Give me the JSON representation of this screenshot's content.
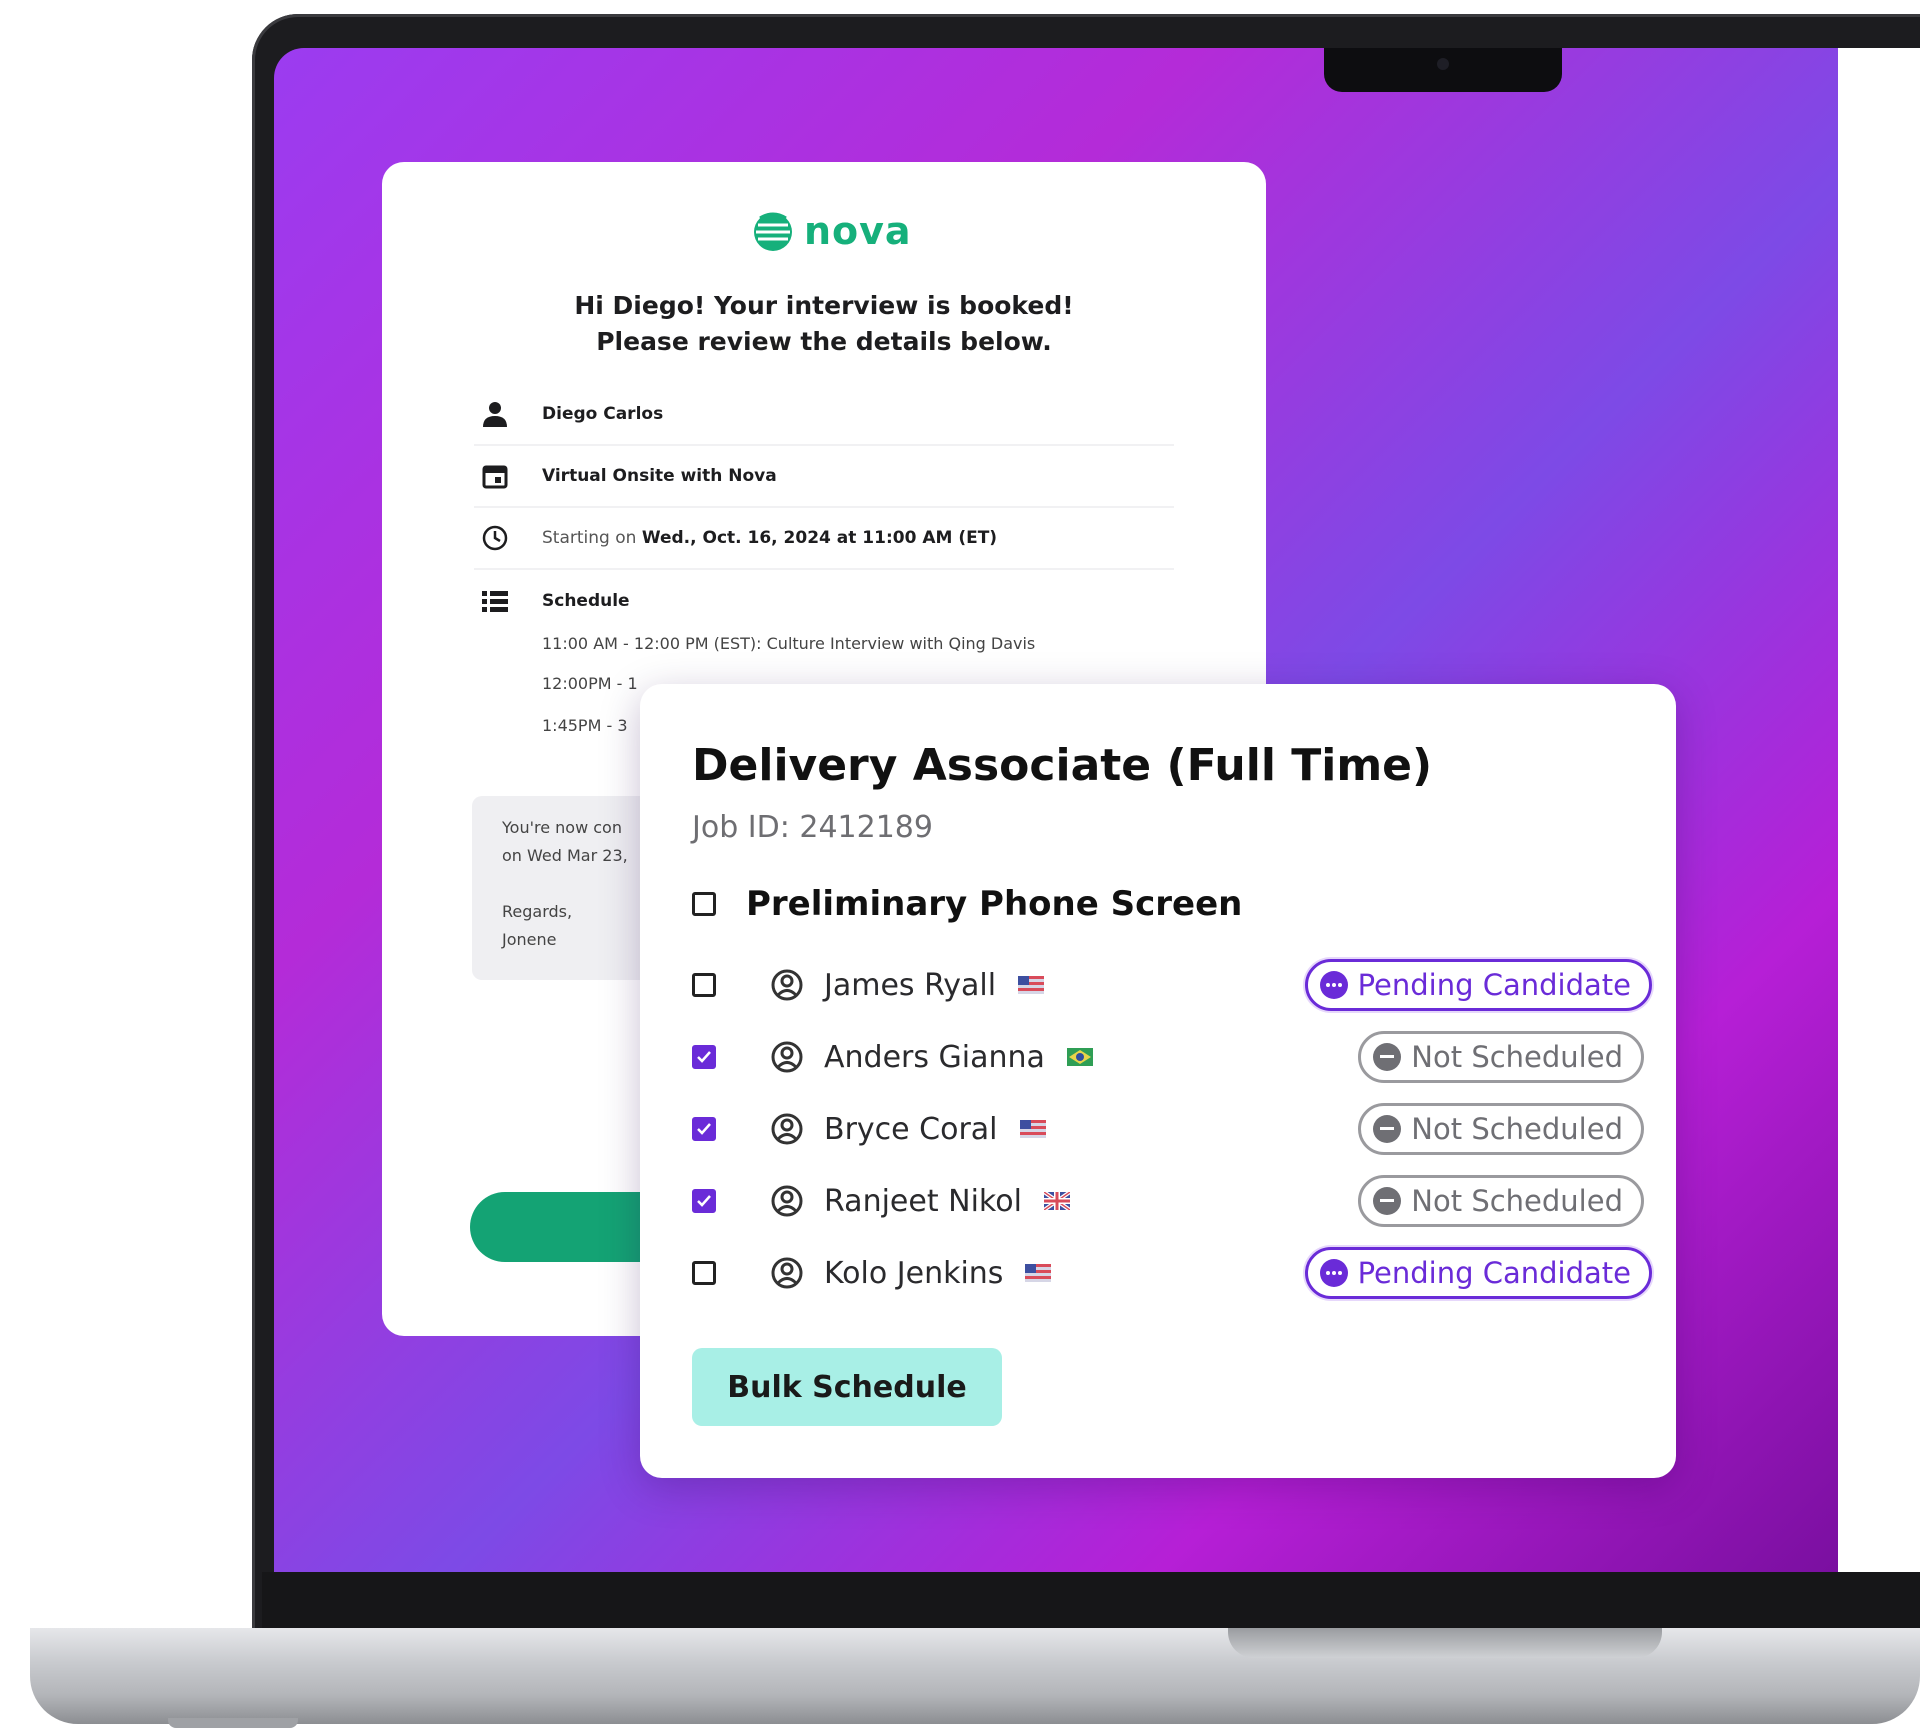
{
  "email": {
    "logo_text": "nova",
    "greeting_line1": "Hi Diego! Your interview is booked!",
    "greeting_line2": "Please review the details below.",
    "candidate_name": "Diego Carlos",
    "event_name": "Virtual Onsite with Nova",
    "starting_prefix": "Starting on",
    "starting_datetime": "Wed., Oct. 16, 2024 at 11:00 AM (ET)",
    "schedule_title": "Schedule",
    "schedule_items": [
      "11:00 AM - 12:00 PM (EST): Culture Interview with Qing Davis",
      "12:00PM - 1",
      "1:45PM - 3"
    ],
    "notice_line1": "You're now con",
    "notice_line2": "on Wed Mar 23,",
    "notice_line3": "Regards,",
    "notice_line4": "Jonene",
    "accent_color": "#16b07b"
  },
  "job": {
    "title": "Delivery Associate (Full Time)",
    "job_id": "Job ID: 2412189",
    "stage": "Preliminary Phone Screen",
    "candidates": [
      {
        "name": "James Ryall",
        "flag": "us-flag",
        "checked": false,
        "status": "Pending Candidate"
      },
      {
        "name": "Anders Gianna",
        "flag": "br-flag",
        "checked": true,
        "status": "Not Scheduled"
      },
      {
        "name": "Bryce Coral",
        "flag": "us-flag",
        "checked": true,
        "status": "Not Scheduled"
      },
      {
        "name": "Ranjeet Nikol",
        "flag": "uk-flag",
        "checked": true,
        "status": "Not Scheduled"
      },
      {
        "name": "Kolo Jenkins",
        "flag": "us-flag",
        "checked": false,
        "status": "Pending Candidate"
      }
    ],
    "bulk_button": "Bulk Schedule",
    "accent_color": "#6a2bd8",
    "button_color": "#a8efe6"
  }
}
